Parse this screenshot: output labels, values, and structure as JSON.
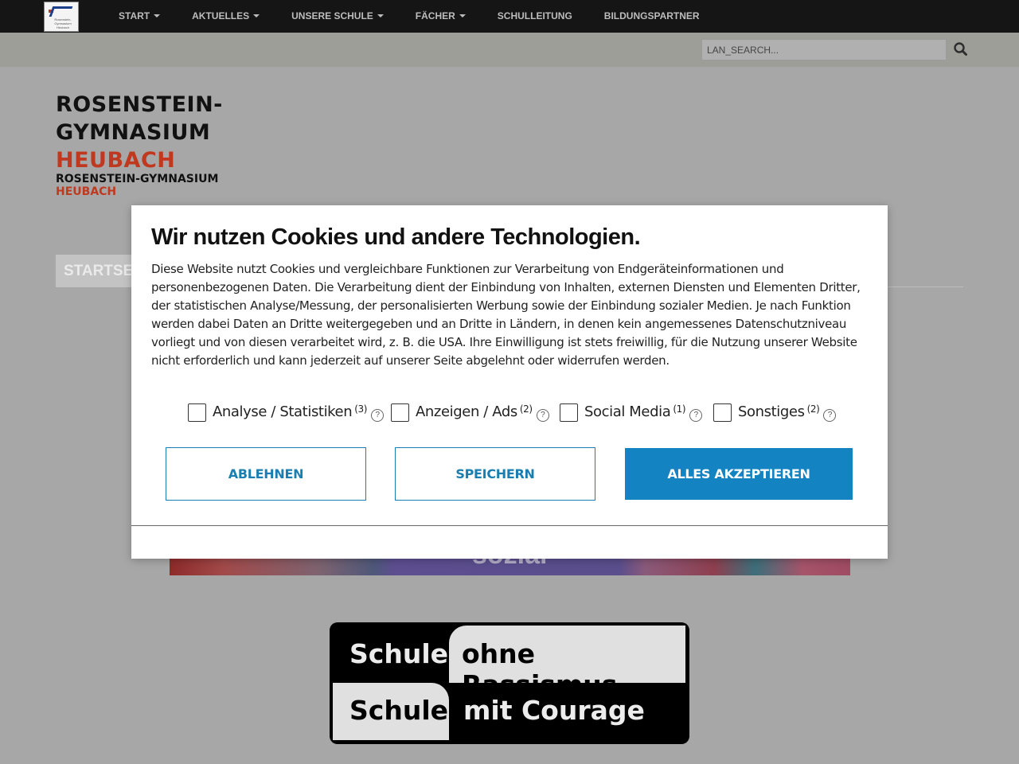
{
  "nav": {
    "logo_text": "Rosenstein-Gymnasium Heubach",
    "items": [
      {
        "label": "START",
        "dropdown": true
      },
      {
        "label": "AKTUELLES",
        "dropdown": true
      },
      {
        "label": "UNSERE SCHULE",
        "dropdown": true
      },
      {
        "label": "FÄCHER",
        "dropdown": true
      },
      {
        "label": "SCHULLEITUNG",
        "dropdown": false
      },
      {
        "label": "BILDUNGSPARTNER",
        "dropdown": false
      }
    ]
  },
  "search": {
    "placeholder": "LAN_SEARCH...",
    "icon": "search-icon"
  },
  "site": {
    "title_line1": "ROSENSTEIN-",
    "title_line2": "GYMNASIUM",
    "title_line3": "HEUBACH",
    "sub_line1": "ROSENSTEIN-GYMNASIUM",
    "sub_line2": "HEUBACH",
    "accent_color": "#c0391f"
  },
  "breadcrumb": {
    "label": "STARTSEITE"
  },
  "banner": {
    "text": "sozial"
  },
  "badge": {
    "row1_left": "Schule",
    "row1_right": "ohne Rassismus",
    "row2_left": "Schule",
    "row2_right": "mit Courage"
  },
  "cookie_modal": {
    "title": "Wir nutzen Cookies und andere Technologien.",
    "body": "Diese Website nutzt Cookies und vergleichbare Funktionen zur Verarbeitung von Endgeräteinformationen und personenbezogenen Daten. Die Verarbeitung dient der Einbindung von Inhalten, externen Diensten und Elementen Dritter, der statistischen Analyse/Messung, der personalisierten Werbung sowie der Einbindung sozialer Medien. Je nach Funktion werden dabei Daten an Dritte weitergegeben und an Dritte in Ländern, in denen kein angemessenes Datenschutzniveau vorliegt und von diesen verarbeitet wird, z. B. die USA. Ihre Einwilligung ist stets freiwillig, für die Nutzung unserer Website nicht erforderlich und kann jederzeit auf unserer Seite abgelehnt oder widerrufen werden.",
    "options": [
      {
        "label": "Analyse / Statistiken",
        "count": "(3)",
        "checked": false
      },
      {
        "label": "Anzeigen / Ads",
        "count": "(2)",
        "checked": false
      },
      {
        "label": "Social Media",
        "count": "(1)",
        "checked": false
      },
      {
        "label": "Sonstiges",
        "count": "(2)",
        "checked": false
      }
    ],
    "help_glyph": "?",
    "buttons": {
      "decline": "ABLEHNEN",
      "save": "SPEICHERN",
      "accept_all": "ALLES AKZEPTIEREN"
    },
    "button_color": "#1383c2"
  }
}
